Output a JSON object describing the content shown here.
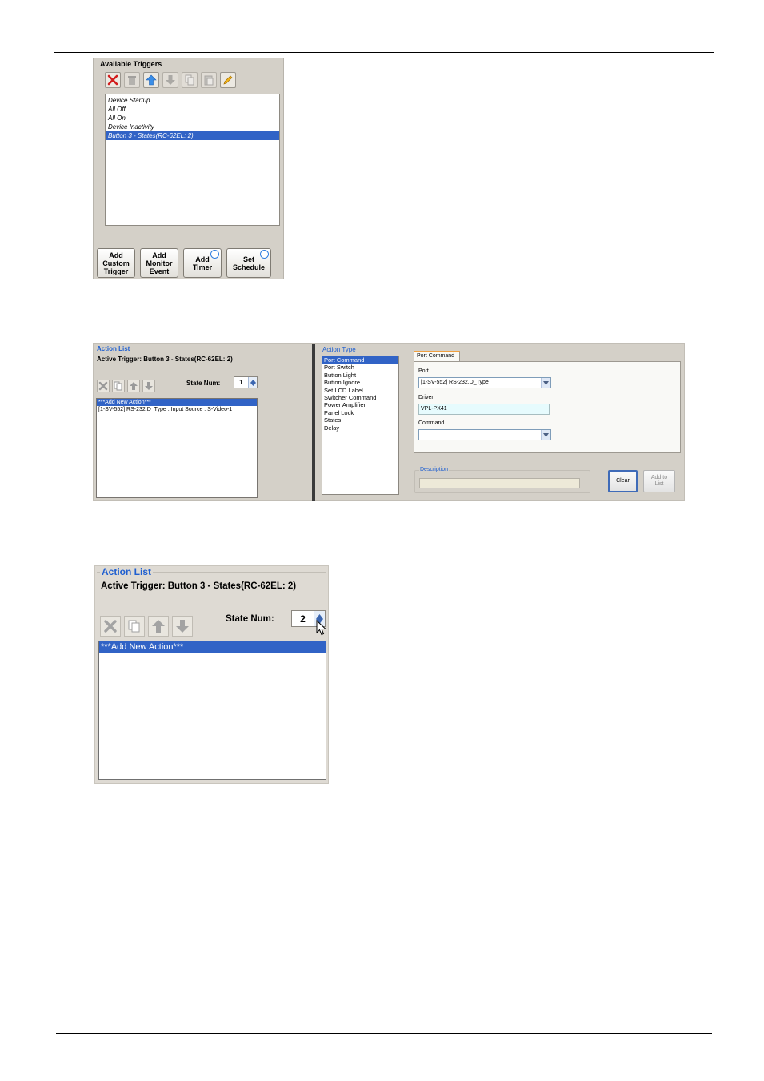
{
  "trigger_panel": {
    "title": "Available Triggers",
    "toolbar_icons": [
      "delete-icon",
      "trash-icon",
      "move-up-icon",
      "move-down-icon",
      "copy-icon",
      "paste-icon",
      "edit-icon"
    ],
    "items": [
      "Device Startup",
      "All Off",
      "All On",
      "Device Inactivity",
      "Button 3 - States(RC-62EL: 2)"
    ],
    "selected_index": 4,
    "buttons": {
      "add_custom": "Add\nCustom\nTrigger",
      "add_monitor": "Add\nMonitor\nEvent",
      "add_timer": "Add\nTimer",
      "set_schedule": "Set\nSchedule"
    }
  },
  "action_wide": {
    "action_list_title": "Action List",
    "active_trigger": "Active Trigger:  Button 3 - States(RC-62EL: 2)",
    "state_num_label": "State Num:",
    "state_num_value": "1",
    "actions": [
      "***Add New Action***",
      "[1-SV-552] RS-232.D_Type : Input Source : S-Video-1"
    ],
    "action_type_title": "Action Type",
    "action_types": [
      "Port Command",
      "Port Switch",
      "Button Light",
      "Button Ignore",
      "Set LCD Label",
      "Switcher Command",
      "Power Amplifier",
      "Panel Lock",
      "States",
      "Delay"
    ],
    "tab_label": "Port Command",
    "port_label": "Port",
    "port_value": "[1-SV-552] RS-232.D_Type",
    "driver_label": "Driver",
    "driver_value": "VPL-PX41",
    "command_label": "Command",
    "command_value": "",
    "description_label": "Description",
    "clear_button": "Clear",
    "add_to_list_button": "Add to\nList"
  },
  "action_zoom": {
    "action_list_title": "Action List",
    "active_trigger": "Active Trigger:  Button 3 - States(RC-62EL: 2)",
    "state_num_label": "State Num:",
    "state_num_value": "2",
    "actions": [
      "***Add New Action***"
    ]
  },
  "colors": {
    "selection": "#3163c6",
    "panel": "#d4d0c8",
    "title_blue": "#1f5fd0"
  }
}
